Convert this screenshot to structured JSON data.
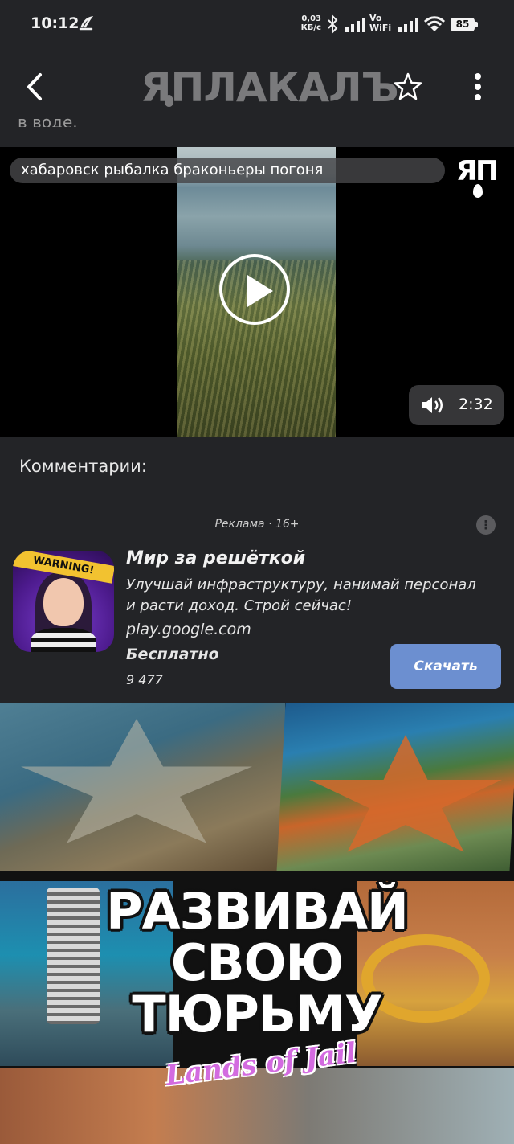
{
  "status_bar": {
    "time": "10:12",
    "net_speed_value": "0,03",
    "net_speed_unit": "КБ/с",
    "volte": "Vo",
    "wifi_label": "WiFi",
    "battery": "85"
  },
  "header": {
    "logo_text": "ЯПЛАКАЛЪ",
    "back_icon": "back-arrow-icon",
    "favorite_icon": "star-icon",
    "menu_icon": "more-vertical-icon"
  },
  "post": {
    "cut_text": "в воде."
  },
  "video": {
    "title": "хабаровск рыбалка браконьеры погоня",
    "channel_logo": "ЯП",
    "duration": "2:32",
    "play_icon": "play-icon",
    "volume_icon": "volume-icon"
  },
  "comments": {
    "title": "Комментарии:"
  },
  "ad": {
    "label": "Реклама · 16+",
    "info_icon": "info-icon",
    "app_icon_banner": "WARNING!",
    "title": "Мир за решёткой",
    "description": "Улучшай инфраструктуру, нанимай персонал и расти доход. Строй сейчас!",
    "domain": "play.google.com",
    "price": "Бесплатно",
    "rating_count": "9 477",
    "cta": "Скачать"
  },
  "banner": {
    "headline_line1": "РАЗВИВАЙ",
    "headline_line2": "СВОЮ",
    "headline_line3": "ТЮРЬМУ",
    "subhead": "Lands of Jail"
  }
}
